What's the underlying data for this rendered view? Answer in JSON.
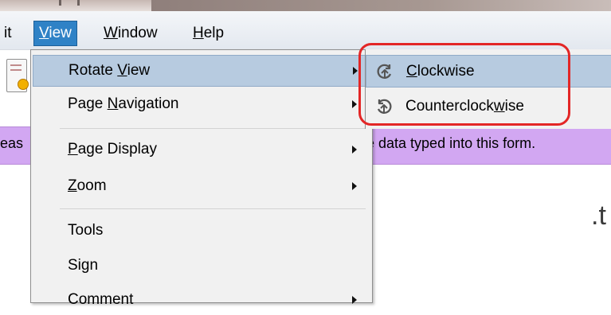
{
  "menubar": {
    "items": [
      {
        "label": "it"
      },
      {
        "prefix": "",
        "mnemonic": "V",
        "rest": "iew",
        "active": true
      },
      {
        "prefix": "",
        "mnemonic": "W",
        "rest": "indow"
      },
      {
        "prefix": "",
        "mnemonic": "H",
        "rest": "elp"
      }
    ]
  },
  "view_menu": {
    "items": [
      {
        "prefix": "Rotate ",
        "mnemonic": "V",
        "rest": "iew",
        "submenu": true,
        "highlighted": true
      },
      {
        "prefix": "Page ",
        "mnemonic": "N",
        "rest": "avigation",
        "submenu": true
      },
      {
        "prefix": "",
        "mnemonic": "P",
        "rest": "age Display",
        "submenu": true
      },
      {
        "prefix": "",
        "mnemonic": "Z",
        "rest": "oom",
        "submenu": true
      },
      {
        "label": "Tools"
      },
      {
        "label": "Sign"
      },
      {
        "label": "Comment",
        "submenu": true
      }
    ]
  },
  "rotate_submenu": {
    "items": [
      {
        "prefix": "",
        "mnemonic": "C",
        "rest": "lockwise",
        "icon": "rotate-clockwise-icon",
        "highlighted": true
      },
      {
        "prefix": "Counterclock",
        "mnemonic": "w",
        "rest": "ise",
        "icon": "rotate-counterclockwise-icon"
      }
    ]
  },
  "document": {
    "left_text": "eas",
    "form_notice": "e data typed into this form.",
    "fragment": ".t"
  },
  "colors": {
    "menu_highlight": "#b7cbe0",
    "menubar_active": "#2f82c6",
    "form_band": "#d2a7f2",
    "annotation": "#e32626"
  }
}
